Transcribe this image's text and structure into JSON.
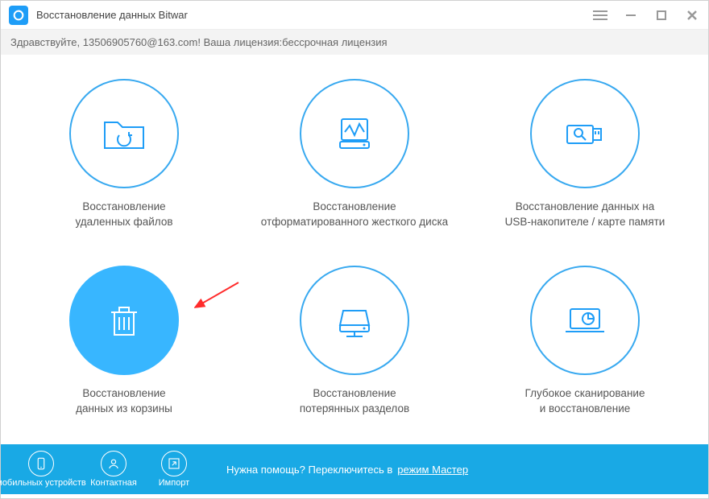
{
  "titlebar": {
    "title": "Восстановление данных Bitwar"
  },
  "greeting": "Здравствуйте, 13506905760@163.com! Ваша лицензия:бессрочная лицензия",
  "options": [
    {
      "line1": "Восстановление",
      "line2": "удаленных файлов"
    },
    {
      "line1": "Восстановление",
      "line2": "отформатированного жесткого диска"
    },
    {
      "line1": "Восстановление данных на",
      "line2": "USB-накопителе / карте памяти"
    },
    {
      "line1": "Восстановление",
      "line2": "данных из корзины"
    },
    {
      "line1": "Восстановление",
      "line2": "потерянных разделов"
    },
    {
      "line1": "Глубокое сканирование",
      "line2": "и восстановление"
    }
  ],
  "footer": {
    "mobile": "мобильных устройств",
    "contact": "Контактная",
    "import": "Импорт",
    "help_prefix": "Нужна помощь? Переключитесь в",
    "help_link": "режим Мастер"
  }
}
